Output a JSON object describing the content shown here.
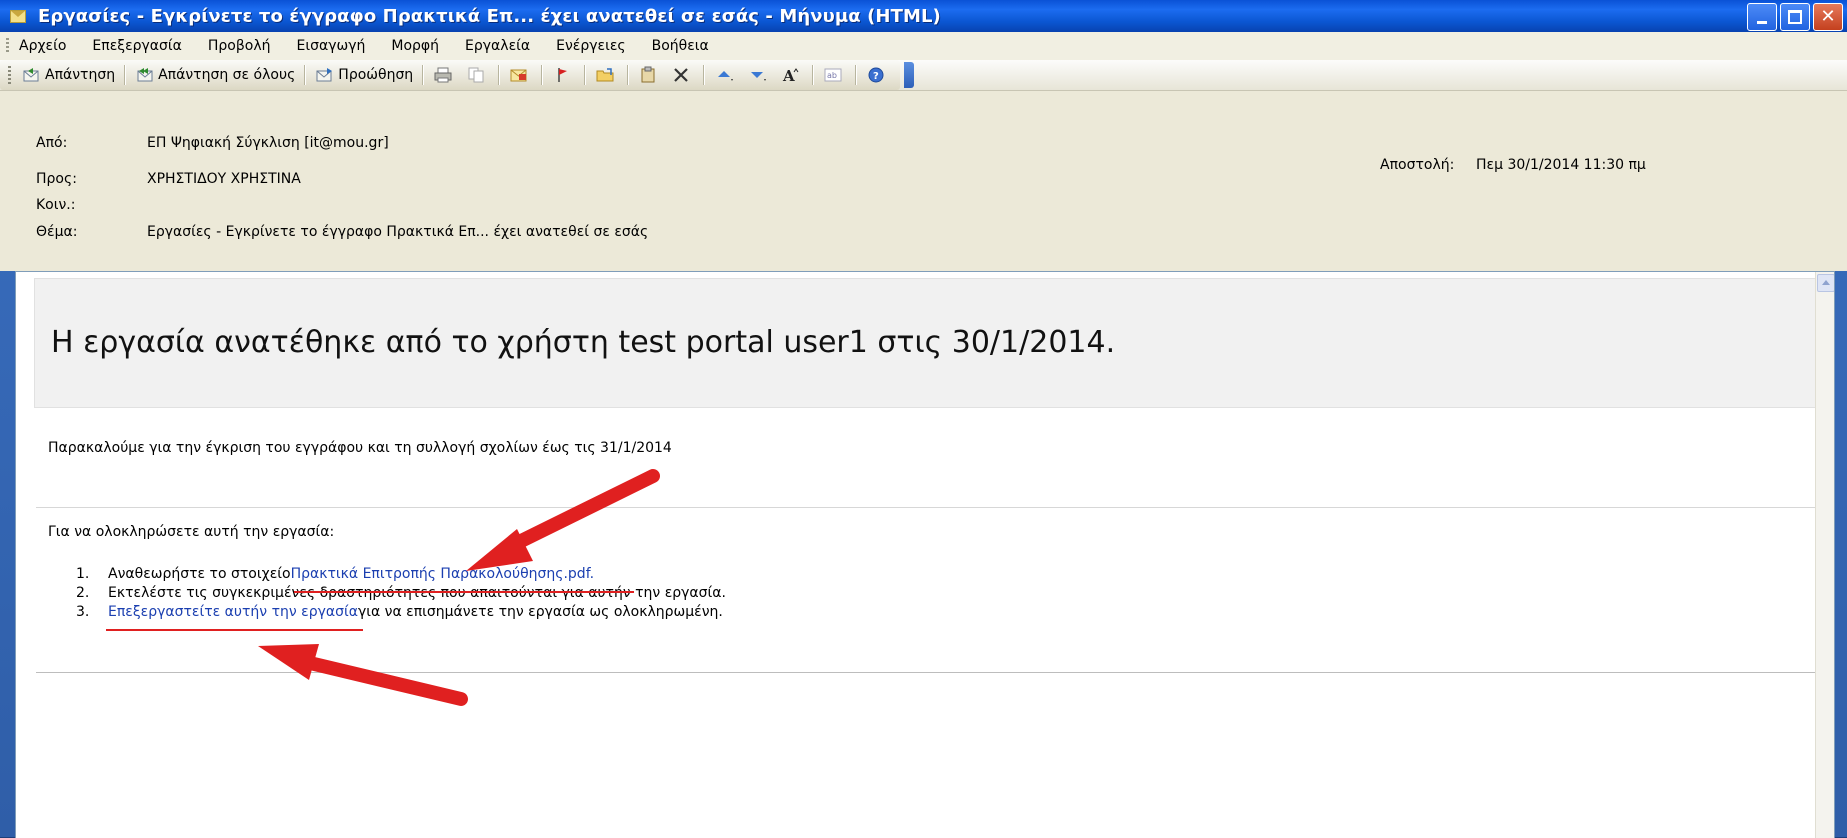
{
  "window": {
    "title": "Εργασίες - Εγκρίνετε το έγγραφο Πρακτικά Επ... έχει ανατεθεί σε εσάς - Μήνυμα (HTML)"
  },
  "menu": {
    "items": [
      "Αρχείο",
      "Επεξεργασία",
      "Προβολή",
      "Εισαγωγή",
      "Μορφή",
      "Εργαλεία",
      "Ενέργειες",
      "Βοήθεια"
    ]
  },
  "toolbar": {
    "reply_label": "Απάντηση",
    "reply_all_label": "Απάντηση σε όλους",
    "forward_label": "Προώθηση"
  },
  "header": {
    "from_label": "Από:",
    "from_value": "ΕΠ Ψηφιακή Σύγκλιση [it@mou.gr]",
    "to_label": "Προς:",
    "to_value": "ΧΡΗΣΤΙΔΟΥ ΧΡΗΣΤΙΝΑ",
    "cc_label": "Κοιν.:",
    "cc_value": "",
    "subject_label": "Θέμα:",
    "subject_value": "Εργασίες - Εγκρίνετε το έγγραφο Πρακτικά Επ... έχει ανατεθεί σε εσάς",
    "sent_label": "Αποστολή:",
    "sent_value": "Πεμ 30/1/2014 11:30 πμ"
  },
  "body": {
    "banner": "Η εργασία ανατέθηκε από το χρήστη test portal user1 στις 30/1/2014.",
    "request": "Παρακαλούμε για την έγκριση του εγγράφου και τη συλλογή σχολίων έως τις 31/1/2014",
    "intro": "Για να ολοκληρώσετε αυτή την εργασία:",
    "steps": [
      {
        "num": "1.",
        "prefix": "Αναθεωρήστε το στοιχείο ",
        "link": "Πρακτικά Επιτροπής Παρακολούθησης.pdf.",
        "suffix": ""
      },
      {
        "num": "2.",
        "prefix": "Εκτελέστε τις συγκεκριμένες δραστηριότητες που απαιτούνται για αυτήν την εργασία.",
        "link": "",
        "suffix": ""
      },
      {
        "num": "3.",
        "prefix": "",
        "link": "Επεξεργαστείτε αυτήν την εργασία",
        "suffix": " για να επισημάνετε την εργασία ως ολοκληρωμένη."
      }
    ]
  },
  "colors": {
    "link": "#1b3fb0",
    "annotation_arrow": "#e02020",
    "header_bg": "#ece9d8"
  }
}
